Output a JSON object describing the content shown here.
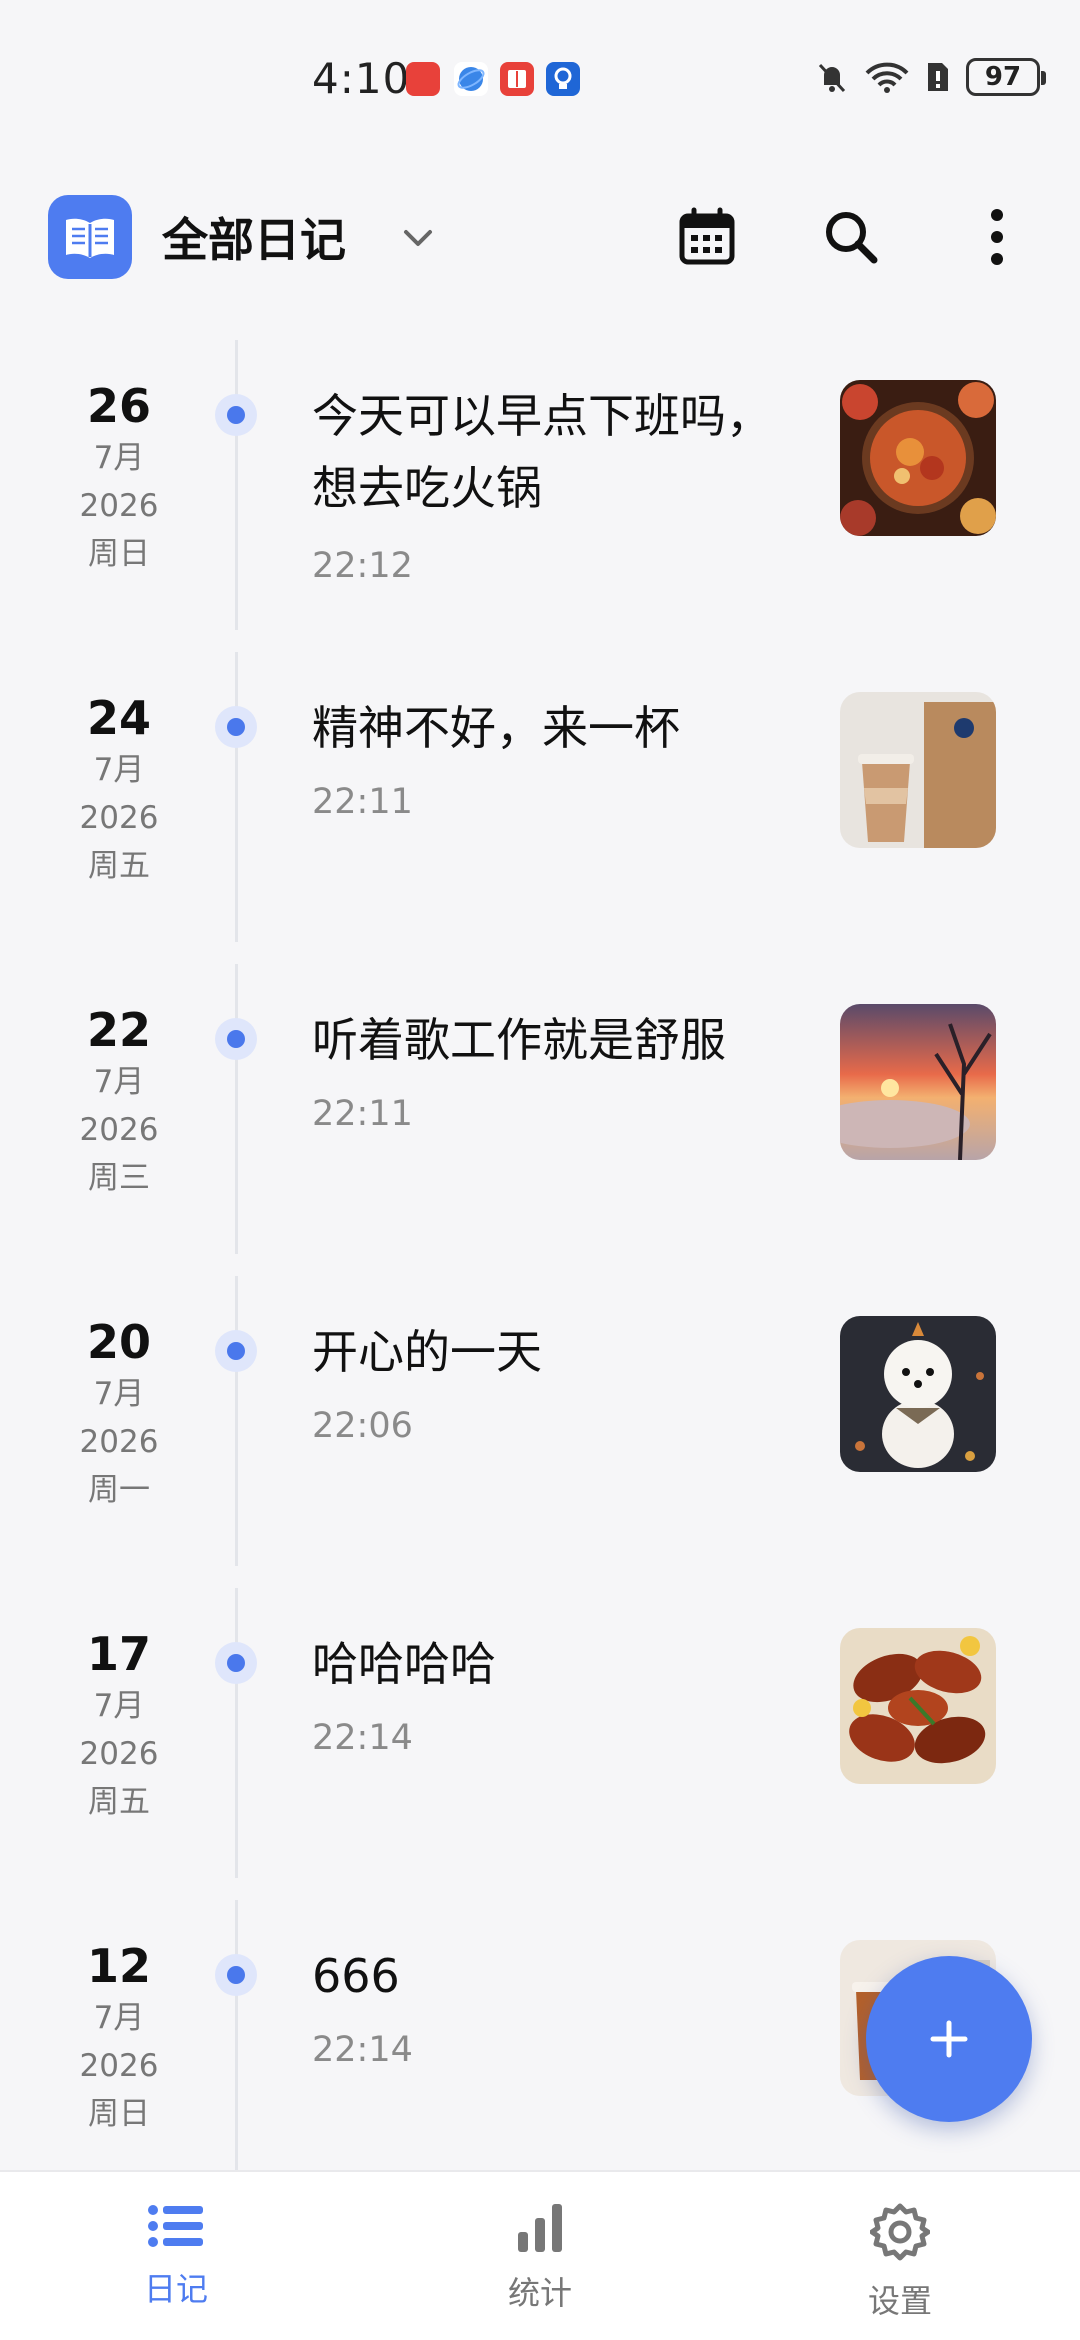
{
  "status_bar": {
    "time": "4:10",
    "battery": "97",
    "icons": [
      "huawei-store-icon",
      "browser-icon",
      "reader-icon",
      "tips-icon",
      "mute-icon",
      "wifi-icon",
      "sim-icon",
      "battery-icon"
    ]
  },
  "header": {
    "title": "全部日记",
    "logo_icon": "book-icon",
    "actions": [
      "calendar-icon",
      "search-icon",
      "more-vert-icon"
    ]
  },
  "colors": {
    "accent": "#4e7cf0",
    "background": "#f6f6f8"
  },
  "entries": [
    {
      "day": "26",
      "month": "7月",
      "year": "2026",
      "weekday": "周日",
      "text": "今天可以早点下班吗，想去吃火锅",
      "time": "22:12",
      "thumb": "hotpot-photo"
    },
    {
      "day": "24",
      "month": "7月",
      "year": "2026",
      "weekday": "周五",
      "text": "精神不好，来一杯",
      "time": "22:11",
      "thumb": "coffee-photo"
    },
    {
      "day": "22",
      "month": "7月",
      "year": "2026",
      "weekday": "周三",
      "text": "听着歌工作就是舒服",
      "time": "22:11",
      "thumb": "sunset-photo"
    },
    {
      "day": "20",
      "month": "7月",
      "year": "2026",
      "weekday": "周一",
      "text": "开心的一天",
      "time": "22:06",
      "thumb": "puppy-photo"
    },
    {
      "day": "17",
      "month": "7月",
      "year": "2026",
      "weekday": "周五",
      "text": "哈哈哈哈",
      "time": "22:14",
      "thumb": "chicken-wings-photo"
    },
    {
      "day": "12",
      "month": "7月",
      "year": "2026",
      "weekday": "周日",
      "text": "666",
      "time": "22:14",
      "thumb": "drink-photo"
    }
  ],
  "fab": {
    "icon": "plus-icon"
  },
  "bottom_nav": [
    {
      "label": "日记",
      "icon": "list-icon",
      "active": true
    },
    {
      "label": "统计",
      "icon": "bar-chart-icon",
      "active": false
    },
    {
      "label": "设置",
      "icon": "gear-icon",
      "active": false
    }
  ]
}
